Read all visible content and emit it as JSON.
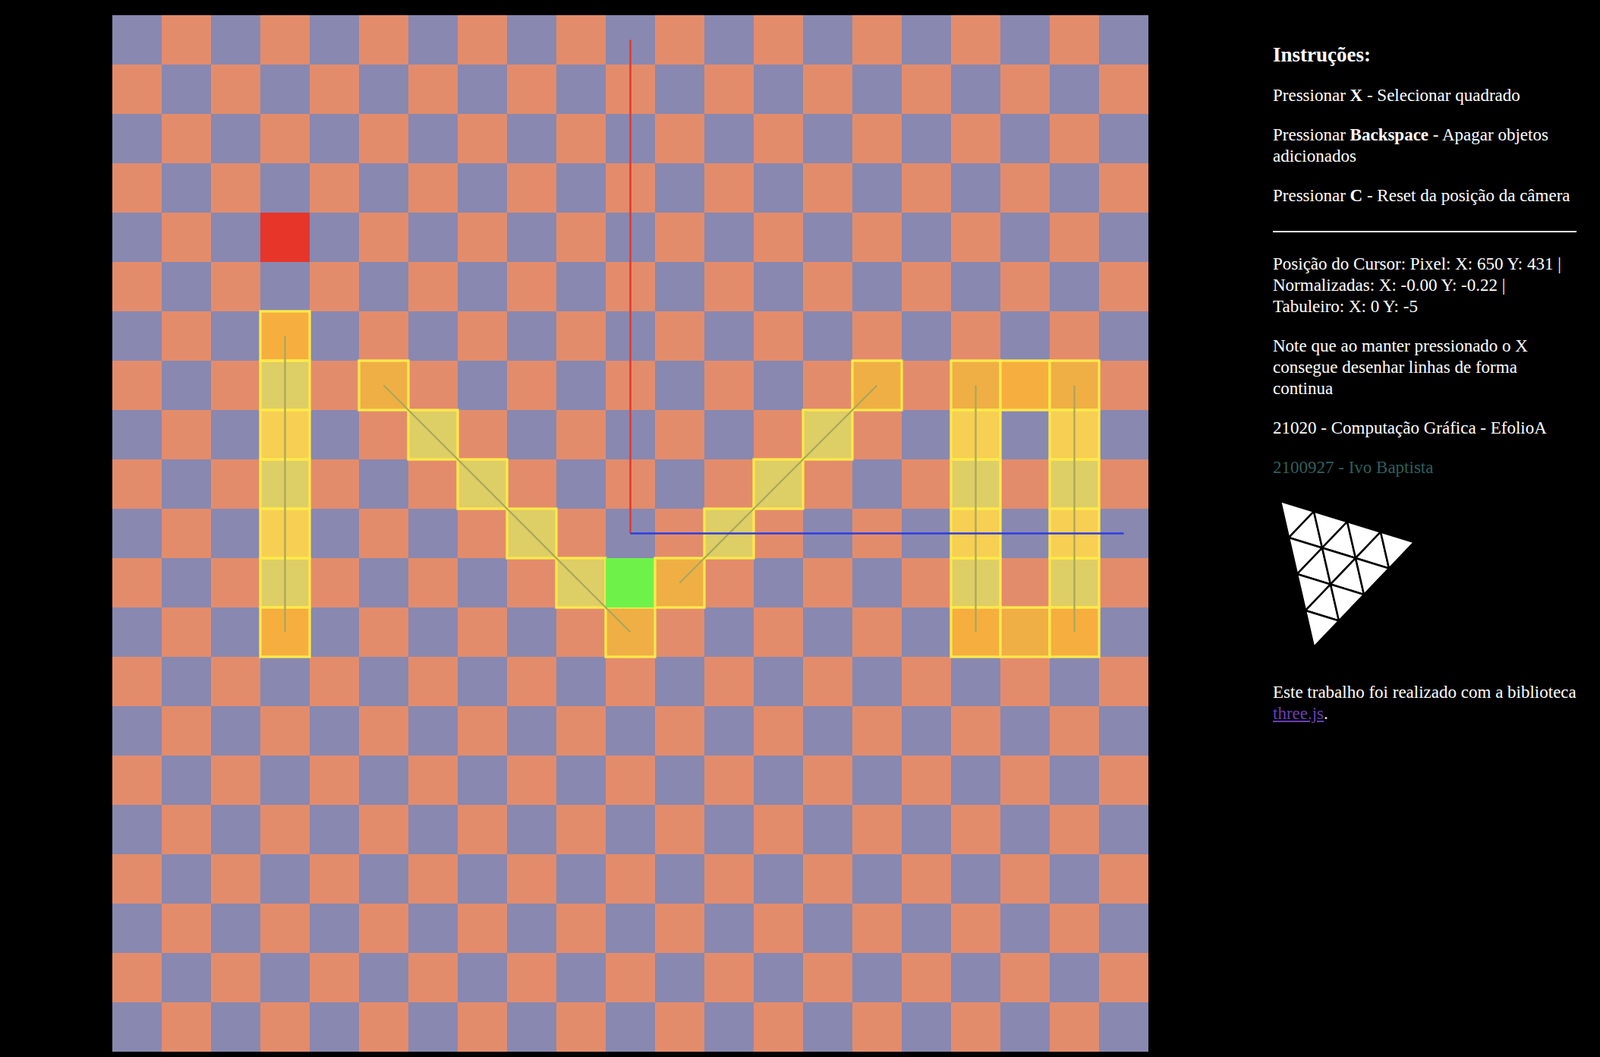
{
  "board": {
    "size": 21,
    "axes": [
      {
        "name": "y",
        "color": "#e5392b",
        "length": 10
      },
      {
        "name": "x",
        "color": "#2f3de0",
        "length": 10
      }
    ],
    "cells": [
      {
        "col": 3,
        "row": 4,
        "kind": "marker"
      },
      {
        "col": 3,
        "row": 6,
        "kind": "endpoint"
      },
      {
        "col": 3,
        "row": 7,
        "kind": "path"
      },
      {
        "col": 3,
        "row": 8,
        "kind": "path"
      },
      {
        "col": 3,
        "row": 9,
        "kind": "path"
      },
      {
        "col": 3,
        "row": 10,
        "kind": "path"
      },
      {
        "col": 3,
        "row": 11,
        "kind": "path"
      },
      {
        "col": 3,
        "row": 12,
        "kind": "endpoint"
      },
      {
        "col": 5,
        "row": 7,
        "kind": "endpoint"
      },
      {
        "col": 6,
        "row": 8,
        "kind": "path"
      },
      {
        "col": 7,
        "row": 9,
        "kind": "path"
      },
      {
        "col": 8,
        "row": 10,
        "kind": "path"
      },
      {
        "col": 9,
        "row": 11,
        "kind": "path"
      },
      {
        "col": 10,
        "row": 12,
        "kind": "endpoint"
      },
      {
        "col": 10,
        "row": 11,
        "kind": "selected"
      },
      {
        "col": 11,
        "row": 11,
        "kind": "endpoint"
      },
      {
        "col": 12,
        "row": 10,
        "kind": "path"
      },
      {
        "col": 13,
        "row": 9,
        "kind": "path"
      },
      {
        "col": 14,
        "row": 8,
        "kind": "path"
      },
      {
        "col": 15,
        "row": 7,
        "kind": "endpoint"
      },
      {
        "col": 17,
        "row": 7,
        "kind": "endpoint"
      },
      {
        "col": 17,
        "row": 8,
        "kind": "path"
      },
      {
        "col": 17,
        "row": 9,
        "kind": "path"
      },
      {
        "col": 17,
        "row": 10,
        "kind": "path"
      },
      {
        "col": 17,
        "row": 11,
        "kind": "path"
      },
      {
        "col": 17,
        "row": 12,
        "kind": "endpoint"
      },
      {
        "col": 18,
        "row": 7,
        "kind": "endpoint"
      },
      {
        "col": 18,
        "row": 12,
        "kind": "endpoint"
      },
      {
        "col": 19,
        "row": 7,
        "kind": "endpoint"
      },
      {
        "col": 19,
        "row": 8,
        "kind": "path"
      },
      {
        "col": 19,
        "row": 9,
        "kind": "path"
      },
      {
        "col": 19,
        "row": 10,
        "kind": "path"
      },
      {
        "col": 19,
        "row": 11,
        "kind": "path"
      },
      {
        "col": 19,
        "row": 12,
        "kind": "endpoint"
      }
    ],
    "lines": [
      {
        "from": [
          3,
          6
        ],
        "to": [
          3,
          12
        ]
      },
      {
        "from": [
          5,
          7
        ],
        "to": [
          10,
          12
        ]
      },
      {
        "from": [
          11,
          11
        ],
        "to": [
          15,
          7
        ]
      },
      {
        "from": [
          17,
          7
        ],
        "to": [
          17,
          12
        ]
      },
      {
        "from": [
          19,
          7
        ],
        "to": [
          19,
          12
        ]
      }
    ]
  },
  "panel": {
    "title": "Instruções:",
    "instructions": [
      {
        "prefix": "Pressionar ",
        "key": "X",
        "text": " - Selecionar quadrado"
      },
      {
        "prefix": "Pressionar ",
        "key": "Backspace",
        "text": " - Apagar objetos adicionados"
      },
      {
        "prefix": "Pressionar ",
        "key": "C",
        "text": " - Reset da posição da câmera"
      }
    ],
    "cursor": "Posição do Cursor: Pixel: X: 650 Y: 431 | Normalizadas: X: -0.00 Y: -0.22 | Tabuleiro: X: 0 Y: -5",
    "note": "Note que ao manter pressionado o X consegue desenhar linhas de forma continua",
    "course": "21020 - Computação Gráfica - EfolioA",
    "author": "2100927 - Ivo Baptista",
    "footer": {
      "before": "Este trabalho foi realizado com a biblioteca ",
      "link": "three.js",
      "after": "."
    }
  }
}
